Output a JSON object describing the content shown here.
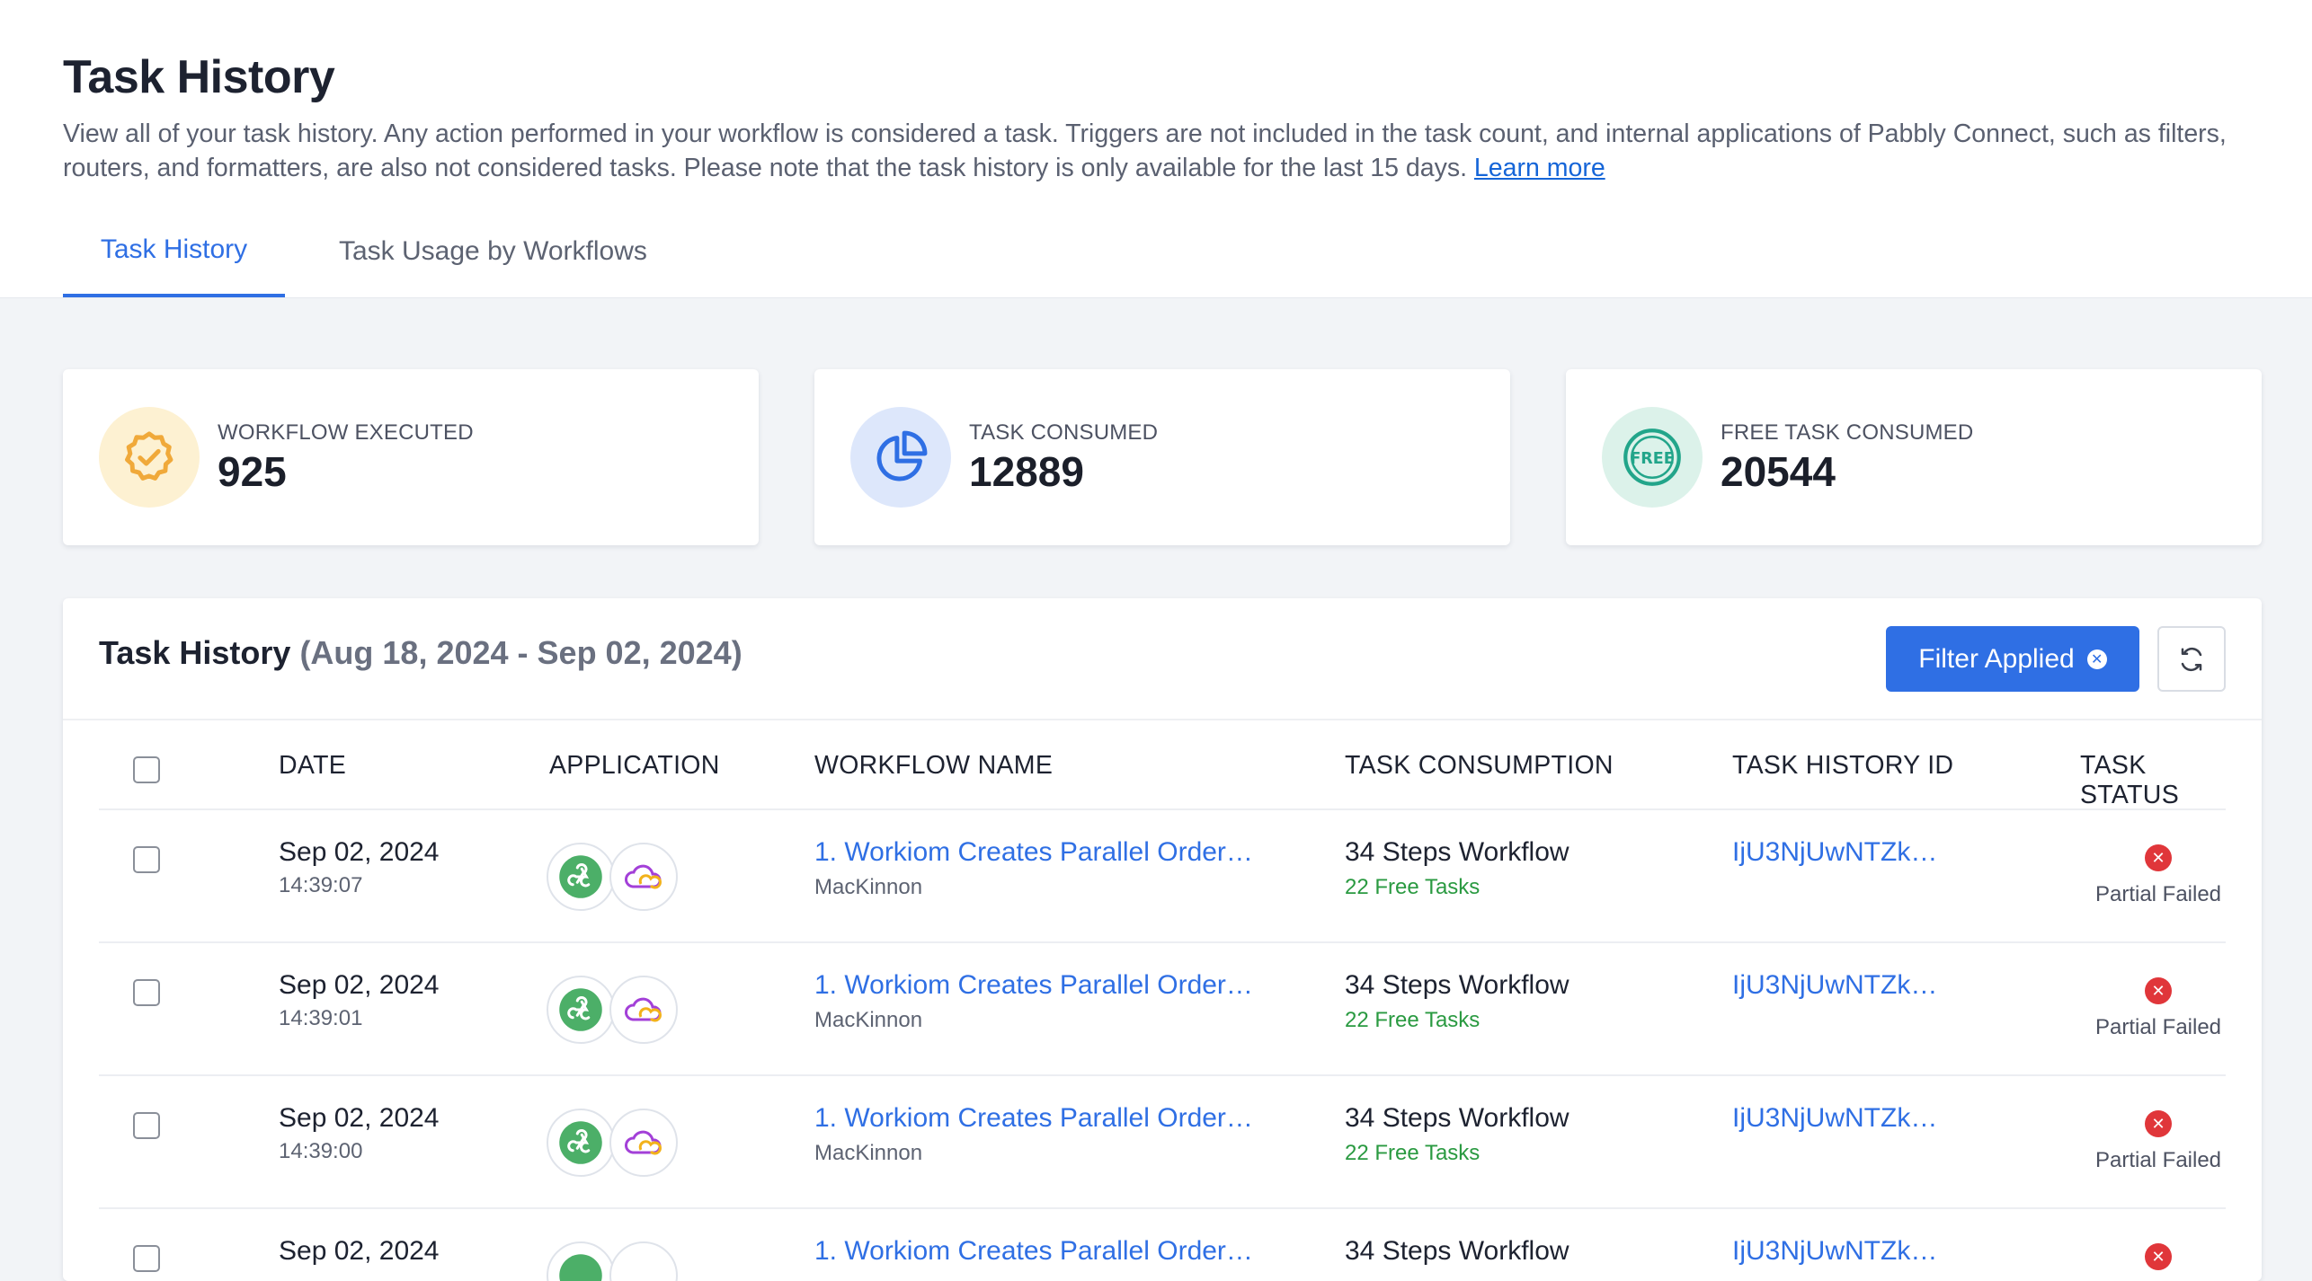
{
  "page": {
    "title": "Task History",
    "description": "View all of your task history. Any action performed in your workflow is considered a task. Triggers are not included in the task count, and internal applications of Pabbly Connect, such as filters, routers, and formatters, are also not considered tasks. Please note that the task history is only available for the last 15 days.",
    "learn_more": "Learn more"
  },
  "tabs": [
    {
      "label": "Task History",
      "active": true
    },
    {
      "label": "Task Usage by Workflows",
      "active": false
    }
  ],
  "stats": [
    {
      "label": "WORKFLOW EXECUTED",
      "value": "925",
      "icon": "badge-check-icon",
      "bg": "#fdf1d2",
      "color": "#f0a93a"
    },
    {
      "label": "TASK CONSUMED",
      "value": "12889",
      "icon": "pie-chart-icon",
      "bg": "#dde7fb",
      "color": "#2f6fe4"
    },
    {
      "label": "FREE TASK CONSUMED",
      "value": "20544",
      "icon": "free-icon",
      "bg": "#dcf2ea",
      "color": "#22a58a"
    }
  ],
  "panel": {
    "title": "Task History",
    "range": "(Aug 18, 2024 - Sep 02, 2024)",
    "filter_label": "Filter Applied"
  },
  "table": {
    "headers": {
      "date": "DATE",
      "application": "APPLICATION",
      "workflow": "WORKFLOW NAME",
      "consumption": "TASK CONSUMPTION",
      "id": "TASK HISTORY ID",
      "status": "TASK STATUS"
    },
    "rows": [
      {
        "date": "Sep 02, 2024",
        "time": "14:39:07",
        "workflow": "1. Workiom Creates Parallel Order…",
        "owner": "MacKinnon",
        "steps": "34 Steps Workflow",
        "free": "22 Free Tasks",
        "id": "IjU3NjUwNTZk…",
        "status": "Partial Failed"
      },
      {
        "date": "Sep 02, 2024",
        "time": "14:39:01",
        "workflow": "1. Workiom Creates Parallel Order…",
        "owner": "MacKinnon",
        "steps": "34 Steps Workflow",
        "free": "22 Free Tasks",
        "id": "IjU3NjUwNTZk…",
        "status": "Partial Failed"
      },
      {
        "date": "Sep 02, 2024",
        "time": "14:39:00",
        "workflow": "1. Workiom Creates Parallel Order…",
        "owner": "MacKinnon",
        "steps": "34 Steps Workflow",
        "free": "22 Free Tasks",
        "id": "IjU3NjUwNTZk…",
        "status": "Partial Failed"
      },
      {
        "date": "Sep 02, 2024",
        "time": "",
        "workflow": "1. Workiom Creates Parallel Order…",
        "owner": "",
        "steps": "34 Steps Workflow",
        "free": "",
        "id": "IjU3NjUwNTZk…",
        "status": ""
      }
    ]
  }
}
